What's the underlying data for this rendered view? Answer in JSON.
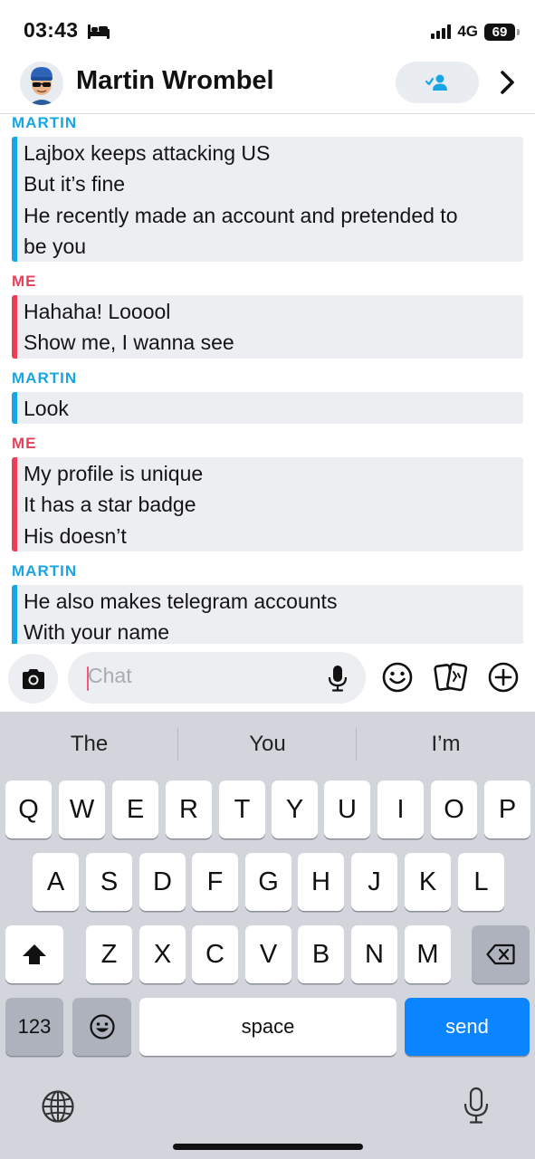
{
  "status_bar": {
    "time": "03:43",
    "network": "4G",
    "battery": "69"
  },
  "header": {
    "contact_name": "Martin Wrombel",
    "avatar_icon": "bitmoji-avatar-icon",
    "add_friend_icon": "add-friend-icon",
    "chevron_icon": "chevron-right-icon"
  },
  "conversation": [
    {
      "sender": "MARTIN",
      "from": "martin",
      "lines": [
        "Lajbox keeps attacking US",
        "But it’s fine",
        "He recently made an account and pretended to",
        "be you"
      ]
    },
    {
      "sender": "ME",
      "from": "me",
      "lines": [
        "Hahaha! Looool",
        "Show me, I wanna see"
      ]
    },
    {
      "sender": "MARTIN",
      "from": "martin",
      "lines": [
        "Look"
      ]
    },
    {
      "sender": "ME",
      "from": "me",
      "lines": [
        "My profile is unique",
        "It has a star badge",
        "His doesn’t"
      ]
    },
    {
      "sender": "MARTIN",
      "from": "martin",
      "lines": [
        "He also makes telegram accounts",
        "With your name"
      ]
    }
  ],
  "input_bar": {
    "placeholder": "Chat",
    "camera_icon": "camera-icon",
    "mic_icon": "microphone-icon",
    "smile_icon": "smiley-face-icon",
    "cards_icon": "cards-icon",
    "plus_icon": "plus-circle-icon"
  },
  "keyboard": {
    "suggestions": [
      "The",
      "You",
      "I’m"
    ],
    "row1": [
      "Q",
      "W",
      "E",
      "R",
      "T",
      "Y",
      "U",
      "I",
      "O",
      "P"
    ],
    "row2": [
      "A",
      "S",
      "D",
      "F",
      "G",
      "H",
      "J",
      "K",
      "L"
    ],
    "row3": [
      "Z",
      "X",
      "C",
      "V",
      "B",
      "N",
      "M"
    ],
    "numbers_label": "123",
    "space_label": "space",
    "send_label": "send",
    "shift_icon": "shift-arrow-icon",
    "backspace_icon": "backspace-icon",
    "emoji_icon": "emoji-icon",
    "globe_icon": "globe-icon",
    "dictation_icon": "microphone-icon"
  },
  "colors": {
    "martin": "#17a6e3",
    "me": "#ea3f56",
    "send": "#0a84ff"
  }
}
